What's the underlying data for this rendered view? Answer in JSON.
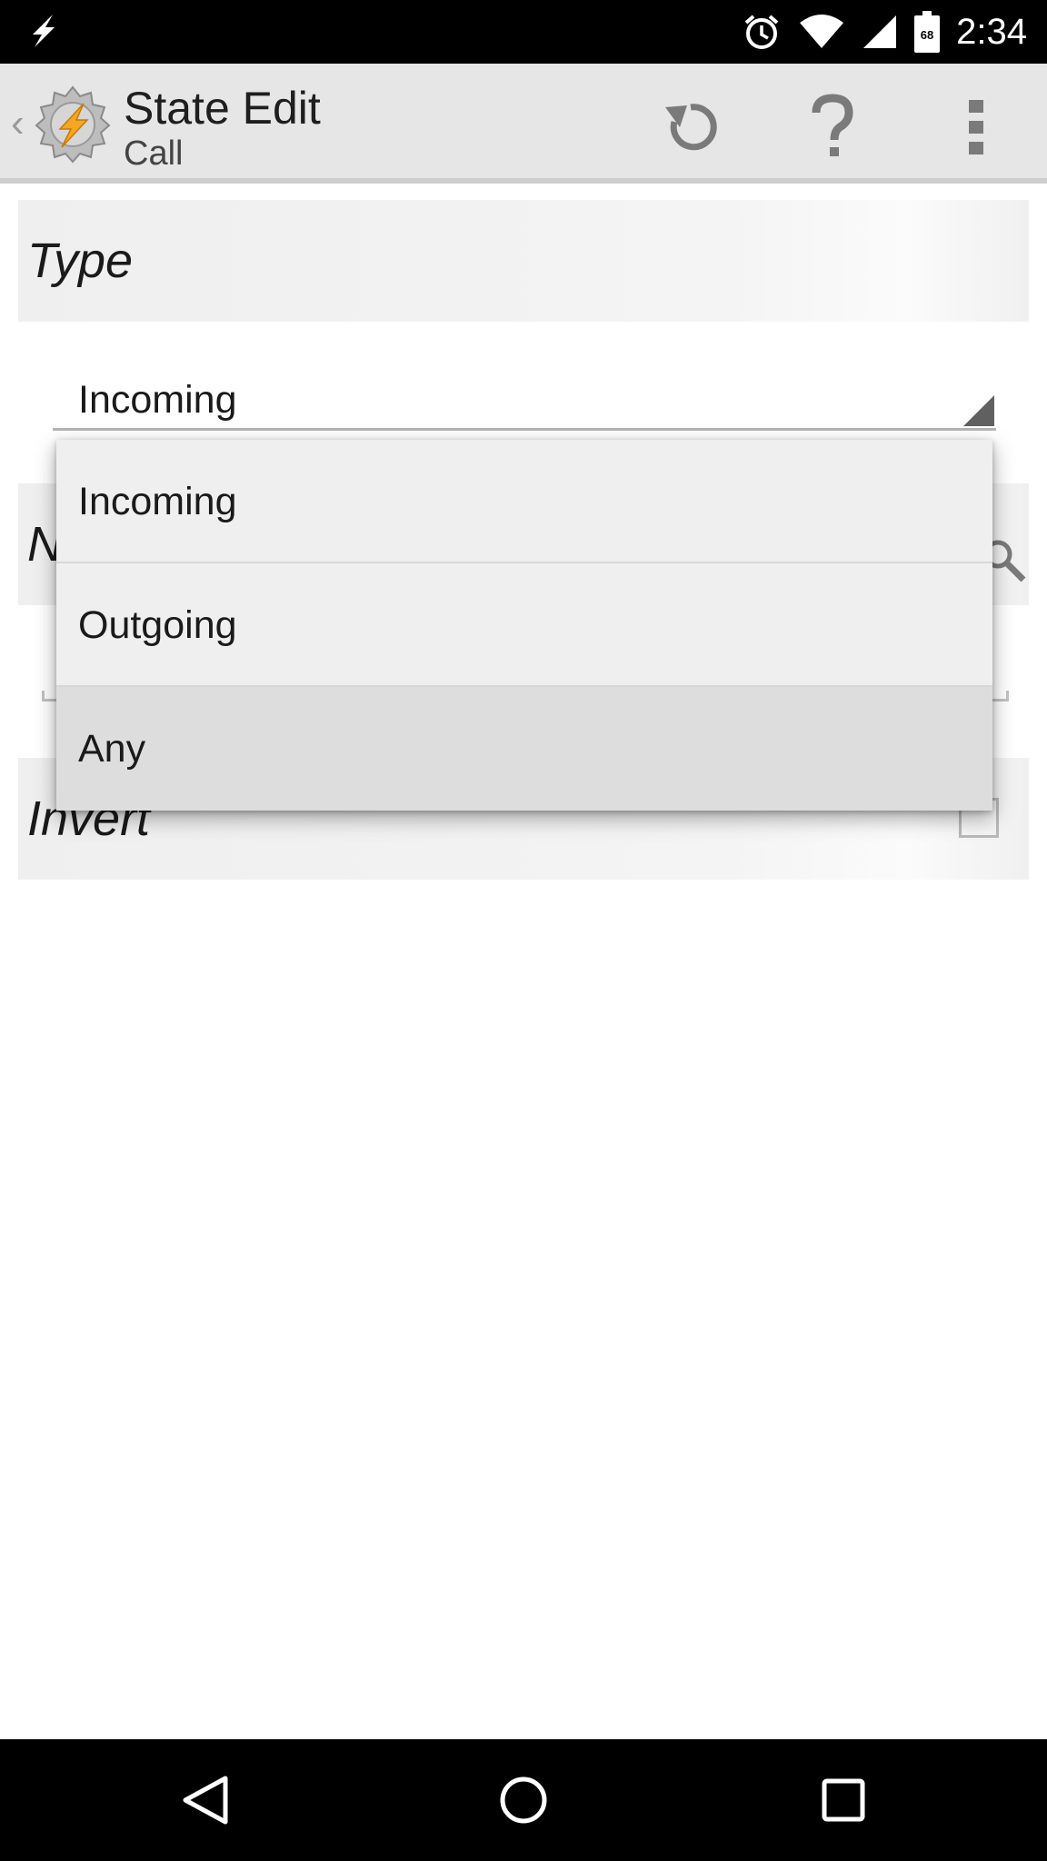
{
  "status_bar": {
    "time": "2:34",
    "battery_level": "68",
    "icons": [
      "lightning-notification-icon",
      "alarm-icon",
      "wifi-icon",
      "cell-signal-icon",
      "battery-icon"
    ]
  },
  "action_bar": {
    "title": "State Edit",
    "subtitle": "Call",
    "back_glyph": "‹",
    "actions": [
      {
        "name": "undo",
        "icon": "undo-icon"
      },
      {
        "name": "help",
        "icon": "help-icon"
      },
      {
        "name": "overflow-menu",
        "icon": "more-vert-icon"
      }
    ]
  },
  "sections": {
    "type": {
      "label": "Type"
    },
    "number": {
      "label": "N"
    },
    "invert": {
      "label": "Invert",
      "checked": false
    }
  },
  "spinner": {
    "selected_value": "Incoming"
  },
  "dropdown": {
    "options": [
      {
        "label": "Incoming",
        "highlighted": false
      },
      {
        "label": "Outgoing",
        "highlighted": false
      },
      {
        "label": "Any",
        "highlighted": true
      }
    ]
  },
  "colors": {
    "status_bar_bg": "#000000",
    "action_bar_bg": "#e6e6e6",
    "section_bg": "#efefef",
    "popup_bg": "#efefef",
    "popup_highlight": "#dddddd",
    "app_icon_orange": "#f5a623"
  }
}
